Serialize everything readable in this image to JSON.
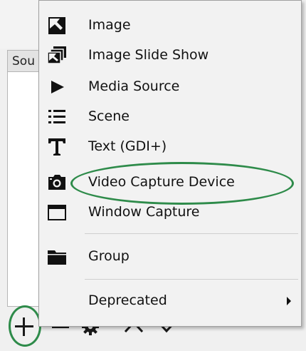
{
  "sources_panel": {
    "tab_label": "Sou"
  },
  "toolbar": {
    "add_icon": "plus-icon",
    "remove_icon": "minus-icon",
    "properties_icon": "gear-icon",
    "move_up_icon": "chevron-up-icon",
    "move_down_icon": "chevron-down-icon"
  },
  "menu": {
    "items": [
      {
        "label": "Image",
        "icon": "image-icon"
      },
      {
        "label": "Image Slide Show",
        "icon": "image-slideshow-icon"
      },
      {
        "label": "Media Source",
        "icon": "play-icon"
      },
      {
        "label": "Scene",
        "icon": "list-icon"
      },
      {
        "label": "Text (GDI+)",
        "icon": "text-icon"
      },
      {
        "label": "Video Capture Device",
        "icon": "camera-icon"
      },
      {
        "label": "Window Capture",
        "icon": "window-icon"
      },
      {
        "label": "Group",
        "icon": "folder-icon"
      },
      {
        "label": "Deprecated",
        "icon": "submenu-arrow-icon"
      }
    ]
  },
  "colors": {
    "highlight": "#2e8b4a",
    "menu_bg": "#f2f2f2"
  }
}
